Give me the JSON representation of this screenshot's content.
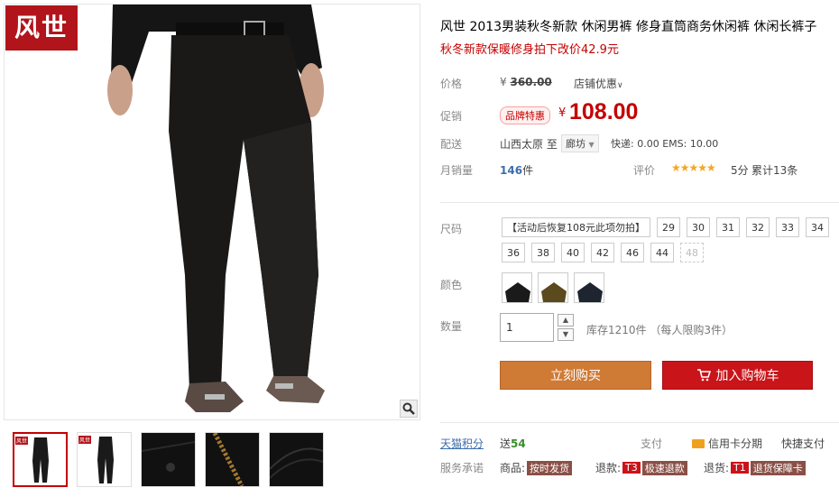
{
  "brand": {
    "logo_text": "风世"
  },
  "product": {
    "title": "风世 2013男装秋冬新款 休闲男裤 修身直筒商务休闲裤 休闲长裤子",
    "subtitle": "秋冬新款保暖修身拍下改价42.9元"
  },
  "price": {
    "label": "价格",
    "original_symbol": "¥",
    "original": "360.00",
    "shop_promo": "店铺优惠"
  },
  "promo": {
    "label": "促销",
    "badge": "品牌特惠",
    "symbol": "¥",
    "price": "108.00"
  },
  "shipping": {
    "label": "配送",
    "from": "山西太原",
    "to_word": "至",
    "to": "廊坊",
    "fee": "快递: 0.00 EMS: 10.00"
  },
  "sales": {
    "label": "月销量",
    "count": "146",
    "unit": "件",
    "rating_label": "评价",
    "stars": "★★★★★",
    "score": "5分",
    "review_count": "累计13条"
  },
  "sizes": {
    "label": "尺码",
    "note": "【活动后恢复108元此项勿拍】",
    "row1": [
      "29",
      "30",
      "31",
      "32",
      "33",
      "34"
    ],
    "row2": [
      "36",
      "38",
      "40",
      "42",
      "46",
      "44"
    ],
    "disabled": "48"
  },
  "colors": {
    "label": "颜色",
    "swatches": [
      "#1a1a1a",
      "#5b4a1e",
      "#1e2430"
    ]
  },
  "quantity": {
    "label": "数量",
    "value": "1",
    "up": "▲",
    "down": "▼",
    "stock": "库存1210件 （每人限购3件）"
  },
  "actions": {
    "buy_now": "立刻购买",
    "add_to_cart": "加入购物车"
  },
  "services": {
    "points_label": "天猫积分",
    "points_prefix": "送",
    "points": "54",
    "pay_label": "支付",
    "card_pay": "信用卡分期",
    "fast_pay": "快捷支付",
    "promise_label": "服务承诺",
    "goods_label": "商品:",
    "goods_tag": "按时发货",
    "return_label": "退款:",
    "return_code": "T3",
    "return_tag": "极速退款",
    "exchange_label": "退货:",
    "exchange_code": "T1",
    "exchange_tag": "退货保障卡"
  }
}
